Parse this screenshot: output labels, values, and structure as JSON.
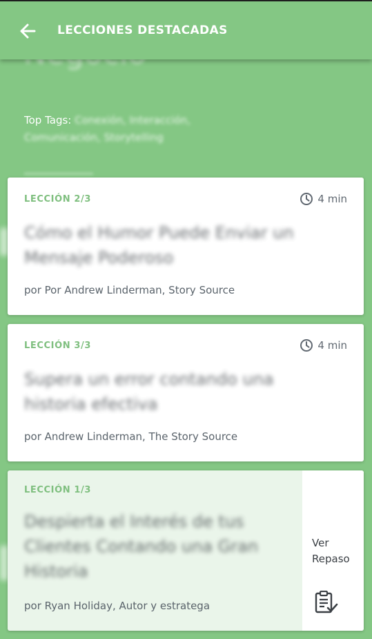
{
  "appbar": {
    "title": "LECCIONES DESTACADAS",
    "back_icon": "arrow-left-icon"
  },
  "hero": {
    "title": "Negocio",
    "tags_label": "Top Tags:",
    "tags_blurred": "Conexión, Interacción,",
    "tags_line2": "Comunicación, Storytelling"
  },
  "lessons": [
    {
      "label": "LECCIÓN 2/3",
      "duration": "4 min",
      "title": "Cómo el Humor Puede Enviar un Mensaje Poderoso",
      "author": "por Por Andrew Linderman, Story Source"
    },
    {
      "label": "LECCIÓN 3/3",
      "duration": "4 min",
      "title": "Supera un error contando una historia efectiva",
      "author": "por Andrew Linderman, The Story Source"
    },
    {
      "label": "LECCIÓN 1/3",
      "title": "Despierta el Interés de tus Clientes Contando una Gran Historia",
      "author": "por Ryan Holiday, Autor y estratega",
      "action_label": "Ver Repaso",
      "action_icon": "clipboard-check-icon"
    }
  ],
  "colors": {
    "primary": "#84c784",
    "accent_text": "#7fbf7f",
    "completed_card": "#eaf5ea"
  }
}
